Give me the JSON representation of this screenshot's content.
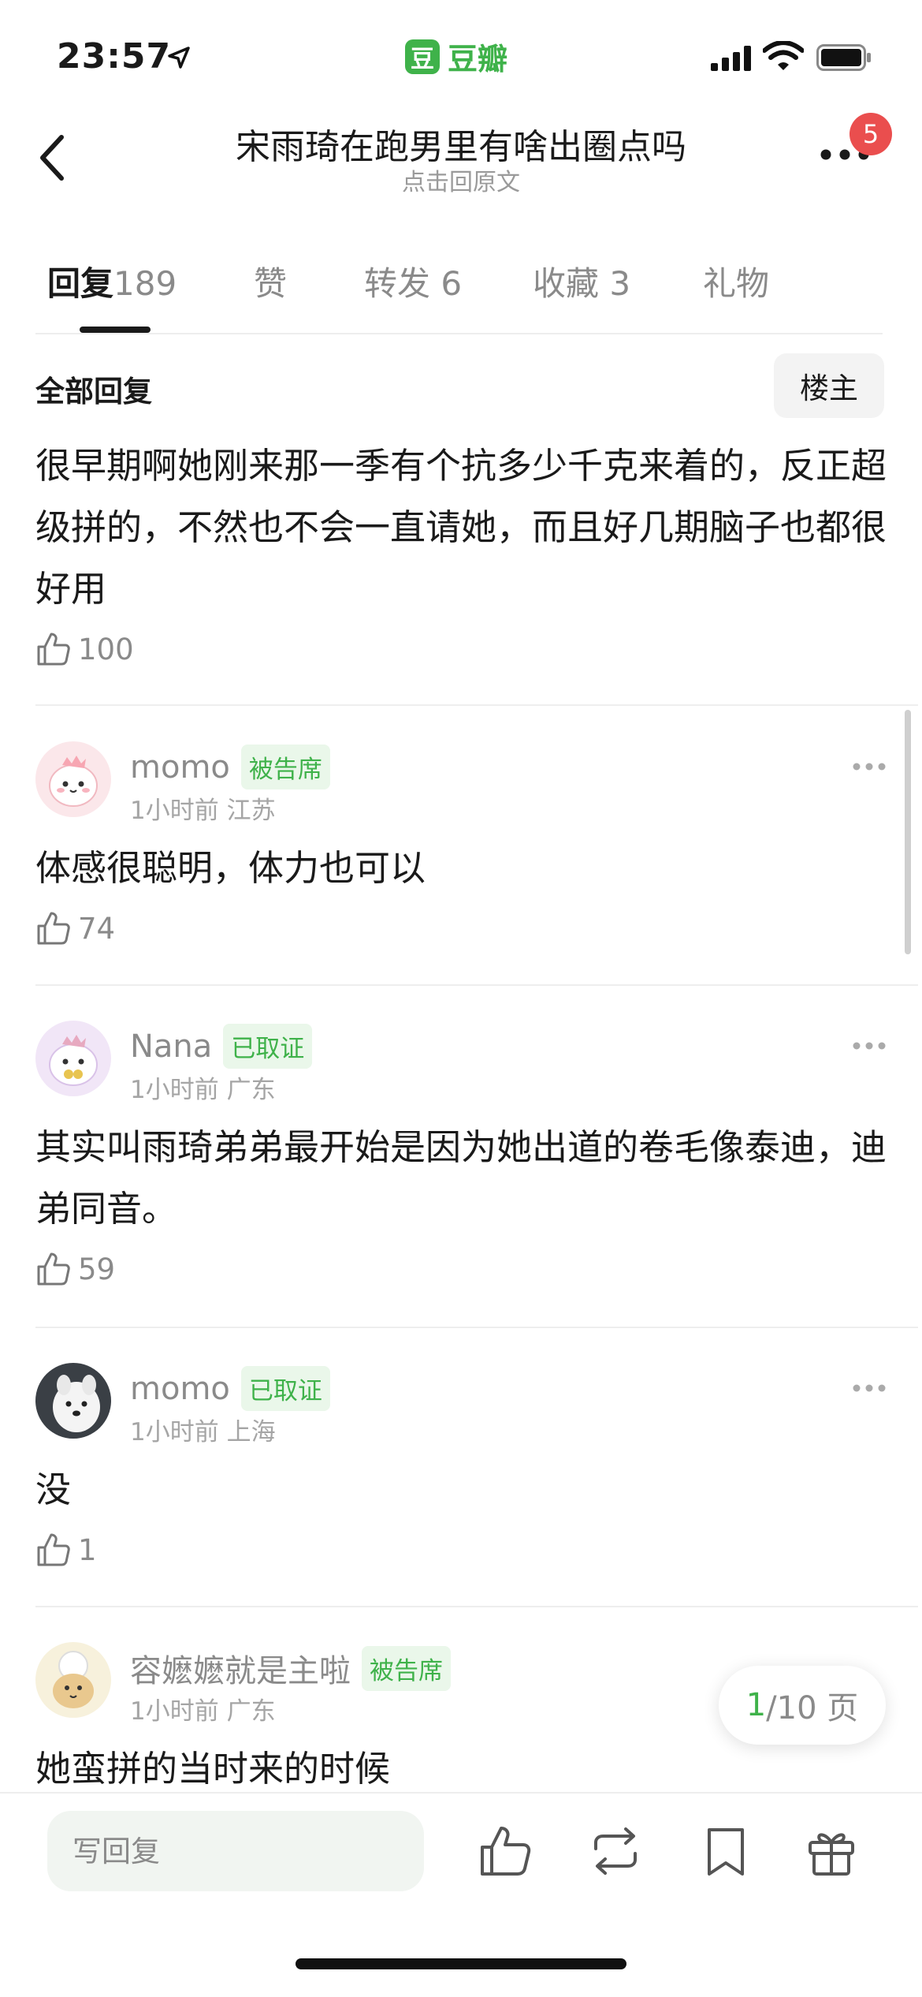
{
  "status_bar": {
    "time": "23:57",
    "app_name": "豆瓣",
    "app_logo_char": "豆"
  },
  "header": {
    "title": "宋雨琦在跑男里有啥出圈点吗",
    "subtitle": "点击回原文",
    "notification_count": "5"
  },
  "tabs": [
    {
      "label": "回复",
      "count": "189",
      "active": true
    },
    {
      "label": "赞",
      "count": "",
      "active": false
    },
    {
      "label": "转发",
      "count": "6",
      "active": false
    },
    {
      "label": "收藏",
      "count": "3",
      "active": false
    },
    {
      "label": "礼物",
      "count": "",
      "active": false
    }
  ],
  "section": {
    "title": "全部回复",
    "filter_button": "楼主"
  },
  "first_reply": {
    "text": "很早期啊她刚来那一季有个抗多少千克来着的，反正超级拼的，不然也不会一直请她，而且好几期脑子也都很好用",
    "likes": "100"
  },
  "comments": [
    {
      "username": "momo",
      "tag": "被告席",
      "time": "1小时前",
      "location": "江苏",
      "text": "体感很聪明，体力也可以",
      "likes": "74"
    },
    {
      "username": "Nana",
      "tag": "已取证",
      "time": "1小时前",
      "location": "广东",
      "text": "其实叫雨琦弟弟最开始是因为她出道的卷毛像泰迪，迪弟同音。",
      "likes": "59"
    },
    {
      "username": "momo",
      "tag": "已取证",
      "time": "1小时前",
      "location": "上海",
      "text": "没",
      "likes": "1"
    },
    {
      "username": "容嬷嬷就是主啦",
      "tag": "被告席",
      "time": "1小时前",
      "location": "广东",
      "text": "她蛮拼的当时来的时候",
      "likes": ""
    }
  ],
  "pagination": {
    "current": "1",
    "total_label": "/10 页"
  },
  "bottom_bar": {
    "reply_placeholder": "写回复"
  },
  "colors": {
    "brand_green": "#3fb24a",
    "badge_red": "#ea4e4e",
    "tag_bg": "#eaf7ea"
  }
}
